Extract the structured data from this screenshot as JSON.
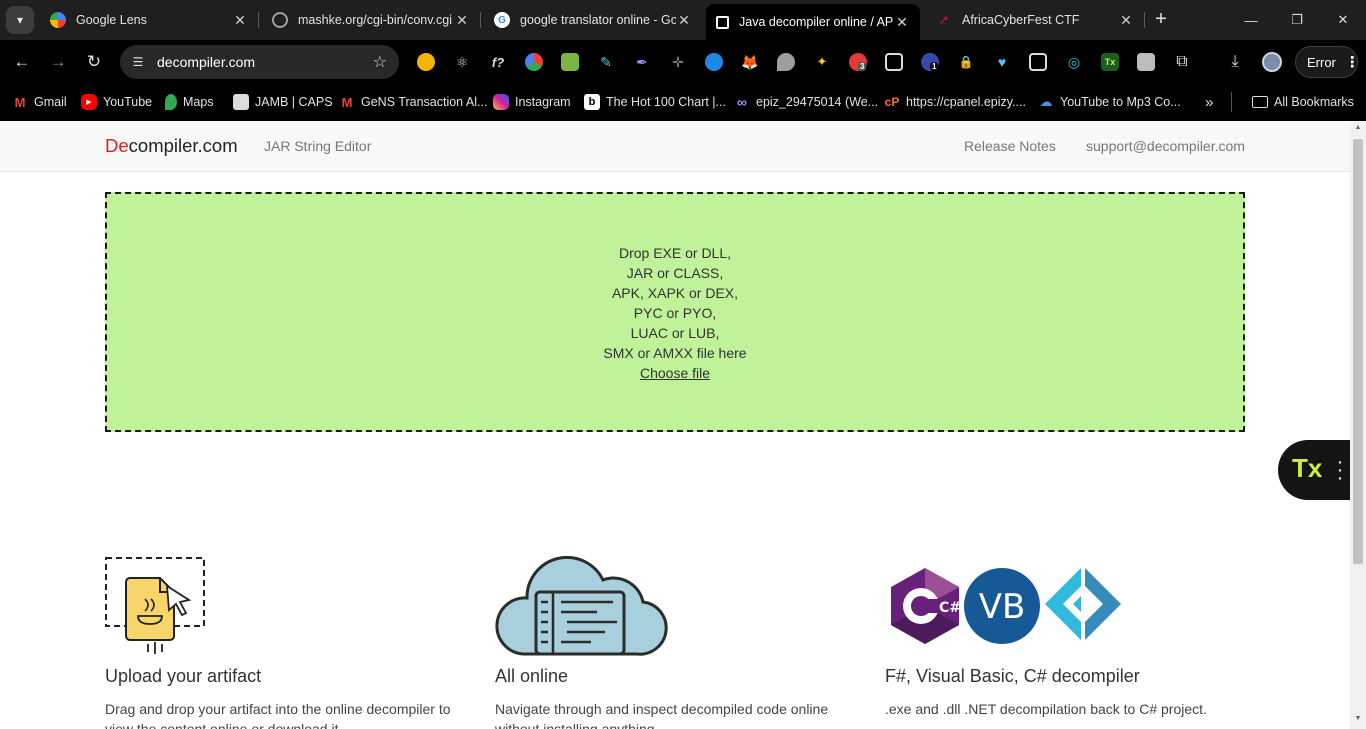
{
  "tabs": [
    {
      "title": "Google Lens",
      "icon": "google-lens-icon",
      "color": "#4285f4"
    },
    {
      "title": "mashke.org/cgi-bin/conv.cgi",
      "icon": "globe-icon",
      "color": "#9aa0a6"
    },
    {
      "title": "google translator online - Go",
      "icon": "google-icon",
      "color": "#ffffff"
    },
    {
      "title": "Java decompiler online / APK",
      "icon": "decompiler-icon",
      "color": "#000000",
      "active": true
    },
    {
      "title": "AfricaCyberFest CTF",
      "icon": "ctf-icon",
      "color": "#c8102e"
    }
  ],
  "toolbar": {
    "url": "decompiler.com",
    "error_label": "Error"
  },
  "bookmarks": [
    {
      "label": "Gmail",
      "icon": "gmail-icon",
      "color": "#ea4335"
    },
    {
      "label": "YouTube",
      "icon": "youtube-icon",
      "color": "#ff0000"
    },
    {
      "label": "Maps",
      "icon": "maps-icon",
      "color": "#34a853"
    },
    {
      "label": "JAMB | CAPS",
      "icon": "jamb-icon",
      "color": "#dddddd"
    },
    {
      "label": "GeNS Transaction Al...",
      "icon": "gmail-icon",
      "color": "#ea4335"
    },
    {
      "label": "Instagram",
      "icon": "instagram-icon",
      "color": "#d6249f"
    },
    {
      "label": "The Hot 100 Chart |...",
      "icon": "billboard-icon",
      "color": "#ffffff"
    },
    {
      "label": "epiz_29475014 (We...",
      "icon": "infinity-icon",
      "color": "#6c63ff"
    },
    {
      "label": "https://cpanel.epizy....",
      "icon": "cpanel-icon",
      "color": "#ff6c2c"
    },
    {
      "label": "YouTube to Mp3 Co...",
      "icon": "download-cloud-icon",
      "color": "#4a90e2"
    }
  ],
  "bookmarks_more": "»",
  "all_bookmarks": "All Bookmarks",
  "site": {
    "brand_red": "De",
    "brand_rest": "compiler.com",
    "nav_left": "JAR String Editor",
    "nav_release": "Release Notes",
    "nav_support": "support@decompiler.com"
  },
  "dropzone": {
    "lines": [
      "Drop EXE or DLL,",
      "JAR or CLASS,",
      "APK, XAPK or DEX,",
      "PYC or PYO,",
      "LUAC or LUB,",
      "SMX or AMXX file here"
    ],
    "choose": "Choose file"
  },
  "features": [
    {
      "title": "Upload your artifact",
      "desc": "Drag and drop your artifact into the online decompiler to view the content online or download it."
    },
    {
      "title": "All online",
      "desc": "Navigate through and inspect decompiled code online without installing anything."
    },
    {
      "title": "F#, Visual Basic, C# decompiler",
      "desc": ".exe and .dll .NET decompilation back to C# project."
    }
  ],
  "logos": {
    "csharp": "C#",
    "vb": "VB"
  },
  "tx_widget": "Tx",
  "ext_badges": {
    "b1": "3",
    "b2": "1"
  },
  "colors": {
    "dropzone_bg": "#c0f29a",
    "brand_red": "#e01e1e"
  }
}
